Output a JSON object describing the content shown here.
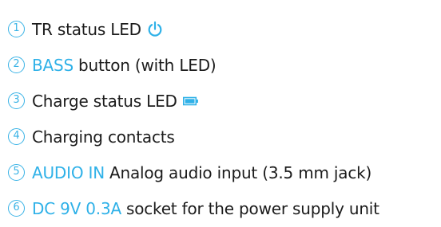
{
  "legend": {
    "items": [
      {
        "number": "1",
        "highlight": "",
        "label": "TR status LED",
        "icon": "power-icon"
      },
      {
        "number": "2",
        "highlight": "BASS",
        "label": "button (with LED)",
        "icon": ""
      },
      {
        "number": "3",
        "highlight": "",
        "label": "Charge status LED",
        "icon": "battery-icon"
      },
      {
        "number": "4",
        "highlight": "",
        "label": "Charging contacts",
        "icon": ""
      },
      {
        "number": "5",
        "highlight": "AUDIO IN",
        "label": "Analog audio input (3.5 mm jack)",
        "icon": ""
      },
      {
        "number": "6",
        "highlight": "DC 9V 0.3A",
        "label": "socket for the power supply unit",
        "icon": ""
      }
    ]
  },
  "colors": {
    "accent": "#2fb1e8",
    "text": "#1b1b1b"
  }
}
